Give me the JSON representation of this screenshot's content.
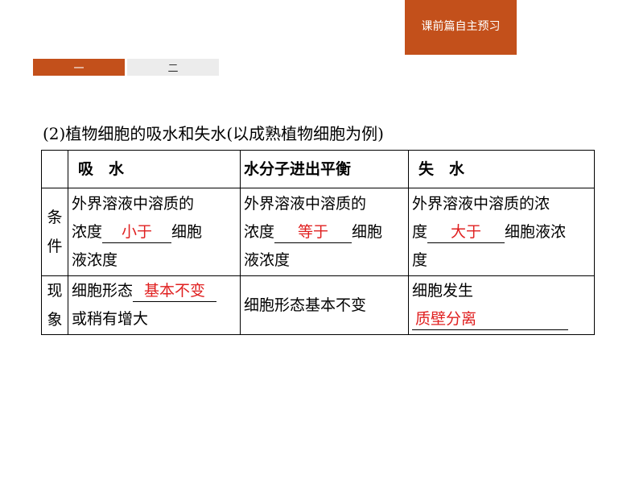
{
  "header": {
    "tab_label": "课前篇自主预习"
  },
  "nav": {
    "tab1": "一",
    "tab2": "二"
  },
  "section": {
    "title": "(2)植物细胞的吸水和失水(以成熟植物细胞为例)"
  },
  "table": {
    "headers": [
      "吸　水",
      "水分子进出平衡",
      "失　水"
    ],
    "row_labels": {
      "condition": "条件",
      "phenomenon": "现象"
    },
    "condition": {
      "absorb": {
        "line1": "外界溶液中溶质的",
        "prefix": "浓度",
        "answer": "小于",
        "suffix": "细胞",
        "line3": "液浓度"
      },
      "balance": {
        "line1": "外界溶液中溶质的",
        "prefix": "浓度",
        "answer": "等于",
        "suffix": "细胞",
        "line3": "液浓度"
      },
      "lose": {
        "line1": "外界溶液中溶质的浓",
        "prefix": "度",
        "answer": "大于",
        "suffix": "细胞液浓",
        "line3": "度"
      }
    },
    "phenomenon": {
      "absorb": {
        "prefix": "细胞形态",
        "answer": "基本不变",
        "line2": "或稍有增大"
      },
      "balance": {
        "text": "细胞形态基本不变"
      },
      "lose": {
        "line1": "细胞发生",
        "answer": "质壁分离"
      }
    }
  },
  "colors": {
    "accent": "#c3501b",
    "answer": "#e02020",
    "inactive_tab": "#ececec"
  }
}
